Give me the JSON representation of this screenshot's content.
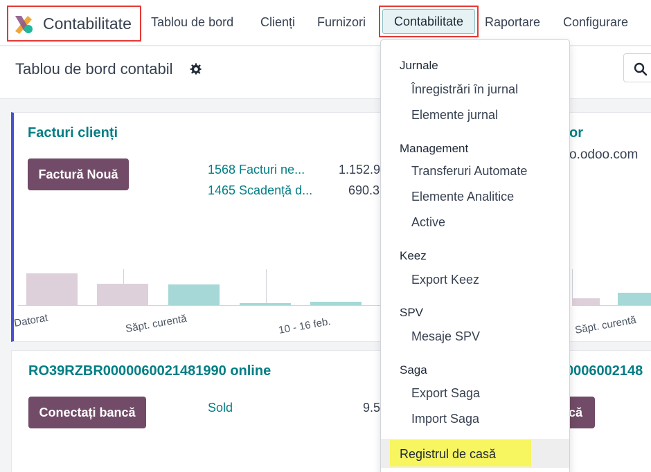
{
  "app": {
    "brand": "Contabilitate"
  },
  "nav": {
    "items": [
      "Tablou de bord",
      "Clienți",
      "Furnizori",
      "Contabilitate",
      "Raportare",
      "Configurare"
    ]
  },
  "control": {
    "title": "Tablou de bord contabil"
  },
  "card_invoices": {
    "title": "Facturi clienți",
    "button": "Factură Nouă",
    "link1": "1568 Facturi ne...",
    "amount1": "1.152.9",
    "link2": "1465 Scadență d...",
    "amount2": "690.3",
    "ticks": [
      "Datorat",
      "Săpt. curentă",
      "10 - 16 feb."
    ],
    "right_title": "or",
    "right_sub": "o.odoo.com",
    "right_tick": "Săpt. curentă"
  },
  "card_bank": {
    "title": "RO39RZBR0000060021481990 online",
    "button": "Conectați bancă",
    "link": "Sold",
    "amount": "9.5",
    "right_title": "0006002148",
    "right_button": "că"
  },
  "dropdown": {
    "sections": [
      {
        "header": "Jurnale",
        "items": [
          "Înregistrări în jurnal",
          "Elemente jurnal"
        ]
      },
      {
        "header": "Management",
        "items": [
          "Transferuri Automate",
          "Elemente Analitice",
          "Active"
        ]
      },
      {
        "header": "Keez",
        "items": [
          "Export Keez"
        ]
      },
      {
        "header": "SPV",
        "items": [
          "Mesaje SPV"
        ]
      },
      {
        "header": "Saga",
        "items": [
          "Export Saga",
          "Import Saga"
        ]
      }
    ],
    "highlighted": "Registrul de casă"
  },
  "colors": {
    "primary": "#714b67",
    "link": "#017e84",
    "bar_past": "#ddd0da",
    "bar_current": "#a5d8d6",
    "highlight": "#f7f560",
    "annotation": "#e53935"
  }
}
